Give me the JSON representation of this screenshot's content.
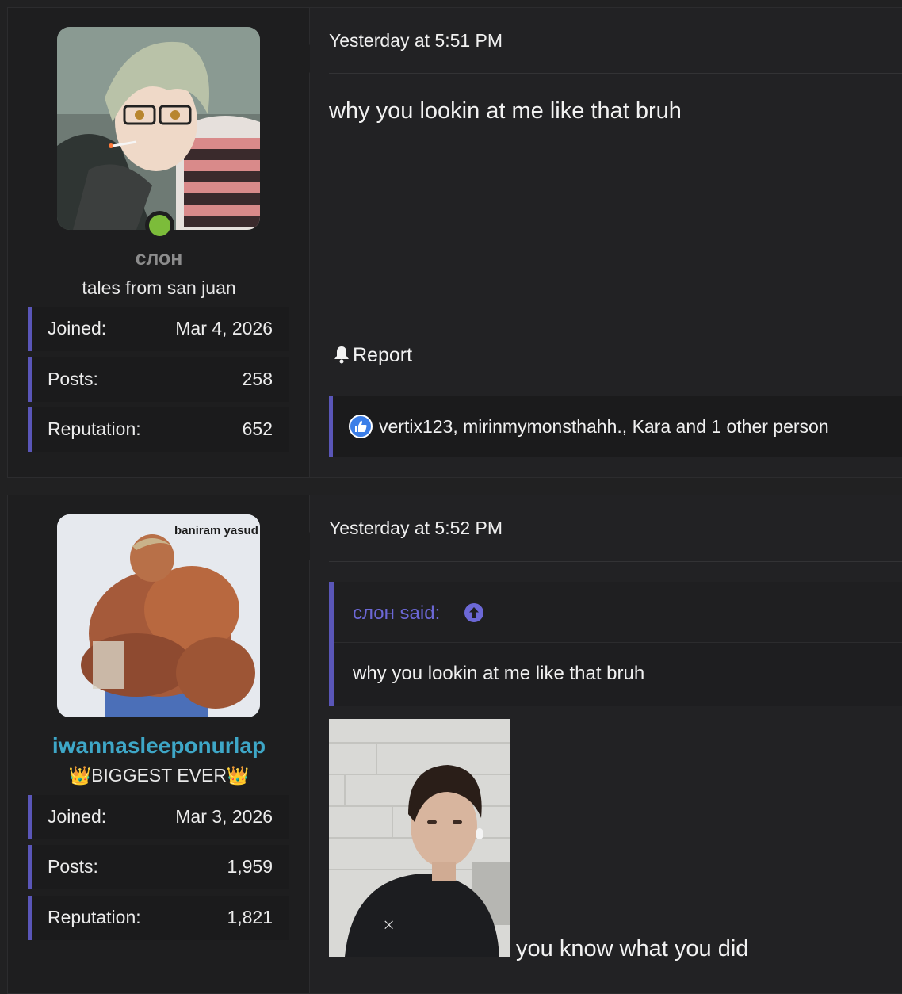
{
  "posts": [
    {
      "user": {
        "name": "слон",
        "title": "tales from san juan",
        "online": true,
        "stats": [
          {
            "label": "Joined:",
            "value": "Mar 4, 2026"
          },
          {
            "label": "Posts:",
            "value": "258"
          },
          {
            "label": "Reputation:",
            "value": "652"
          }
        ]
      },
      "timestamp": "Yesterday at 5:51 PM",
      "message": "why you lookin at me like that bruh",
      "report_label": "Report",
      "reactions": "vertix123, mirinmymonsthahh., Kara and 1 other person"
    },
    {
      "user": {
        "name": "iwannasleeponurlap",
        "title": "👑BIGGEST EVER👑",
        "avatar_text": "baniram yasud",
        "stats": [
          {
            "label": "Joined:",
            "value": "Mar 3, 2026"
          },
          {
            "label": "Posts:",
            "value": "1,959"
          },
          {
            "label": "Reputation:",
            "value": "1,821"
          }
        ]
      },
      "timestamp": "Yesterday at 5:52 PM",
      "quote": {
        "author": "слон said:",
        "body": "why you lookin at me like that bruh"
      },
      "caption": "you know what you did"
    }
  ],
  "colors": {
    "accent": "#5a56b8",
    "online": "#7cbc3a",
    "username_highlight": "#3ea7c7",
    "quote_author": "#6c68d6"
  },
  "icons": [
    "bell-icon",
    "like-icon",
    "arrow-up-circle-icon"
  ]
}
